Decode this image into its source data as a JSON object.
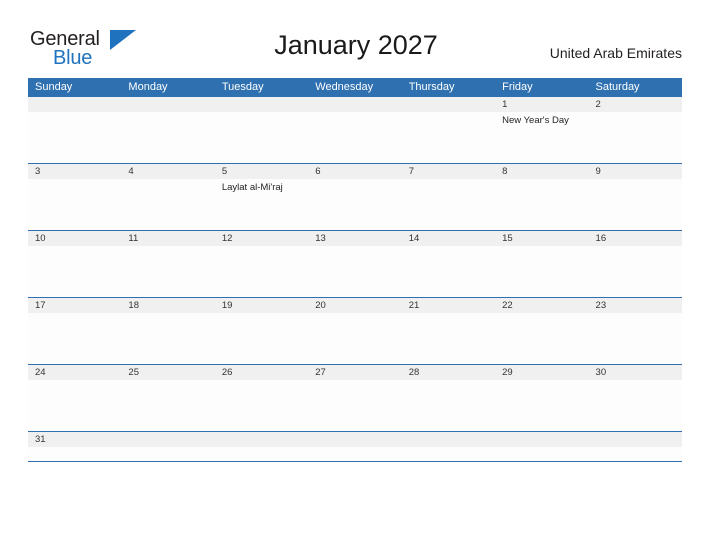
{
  "brand": {
    "name_part1": "General",
    "name_part2": "Blue",
    "triangle_icon": "triangle-logo-icon",
    "colors": {
      "text_dark": "#231f20",
      "blue": "#1f72bd"
    }
  },
  "header": {
    "title": "January 2027",
    "country": "United Arab Emirates"
  },
  "colors": {
    "header_blue": "#2e70b0",
    "date_band_gray": "#f0f0f0",
    "divider_blue": "#2e70b0",
    "cell_white": "#fdfdfd"
  },
  "calendar": {
    "weekdays": [
      "Sunday",
      "Monday",
      "Tuesday",
      "Wednesday",
      "Thursday",
      "Friday",
      "Saturday"
    ],
    "weeks": [
      {
        "days": [
          {
            "date": "",
            "events": []
          },
          {
            "date": "",
            "events": []
          },
          {
            "date": "",
            "events": []
          },
          {
            "date": "",
            "events": []
          },
          {
            "date": "",
            "events": []
          },
          {
            "date": "1",
            "events": [
              "New Year's Day"
            ]
          },
          {
            "date": "2",
            "events": []
          }
        ]
      },
      {
        "days": [
          {
            "date": "3",
            "events": []
          },
          {
            "date": "4",
            "events": []
          },
          {
            "date": "5",
            "events": [
              "Laylat al-Mi'raj"
            ]
          },
          {
            "date": "6",
            "events": []
          },
          {
            "date": "7",
            "events": []
          },
          {
            "date": "8",
            "events": []
          },
          {
            "date": "9",
            "events": []
          }
        ]
      },
      {
        "days": [
          {
            "date": "10",
            "events": []
          },
          {
            "date": "11",
            "events": []
          },
          {
            "date": "12",
            "events": []
          },
          {
            "date": "13",
            "events": []
          },
          {
            "date": "14",
            "events": []
          },
          {
            "date": "15",
            "events": []
          },
          {
            "date": "16",
            "events": []
          }
        ]
      },
      {
        "days": [
          {
            "date": "17",
            "events": []
          },
          {
            "date": "18",
            "events": []
          },
          {
            "date": "19",
            "events": []
          },
          {
            "date": "20",
            "events": []
          },
          {
            "date": "21",
            "events": []
          },
          {
            "date": "22",
            "events": []
          },
          {
            "date": "23",
            "events": []
          }
        ]
      },
      {
        "days": [
          {
            "date": "24",
            "events": []
          },
          {
            "date": "25",
            "events": []
          },
          {
            "date": "26",
            "events": []
          },
          {
            "date": "27",
            "events": []
          },
          {
            "date": "28",
            "events": []
          },
          {
            "date": "29",
            "events": []
          },
          {
            "date": "30",
            "events": []
          }
        ]
      },
      {
        "days": [
          {
            "date": "31",
            "events": []
          },
          {
            "date": "",
            "events": []
          },
          {
            "date": "",
            "events": []
          },
          {
            "date": "",
            "events": []
          },
          {
            "date": "",
            "events": []
          },
          {
            "date": "",
            "events": []
          },
          {
            "date": "",
            "events": []
          }
        ]
      }
    ]
  }
}
